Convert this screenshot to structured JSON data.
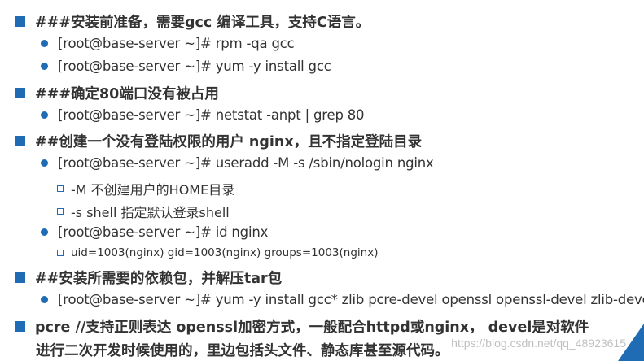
{
  "lines": [
    {
      "level": 1,
      "text": "###安装前准备，需要gcc 编译工具，支持C语言。"
    },
    {
      "level": 2,
      "text": "[root@base-server ~]# rpm -qa gcc"
    },
    {
      "level": 2,
      "text": "[root@base-server ~]# yum -y install gcc"
    },
    {
      "level": 1,
      "text": "###确定80端口没有被占用"
    },
    {
      "level": 2,
      "text": "[root@base-server ~]# netstat -anpt | grep 80"
    },
    {
      "level": 1,
      "text": "##创建一个没有登陆权限的用户 nginx，且不指定登陆目录"
    },
    {
      "level": 2,
      "text": "[root@base-server ~]# useradd -M -s /sbin/nologin nginx"
    },
    {
      "level": 3,
      "text": "-M 不创建用户的HOME目录"
    },
    {
      "level": 3,
      "text": "-s shell 指定默认登录shell"
    },
    {
      "level": 2,
      "text": "[root@base-server ~]# id nginx"
    },
    {
      "level": 3,
      "text": "uid=1003(nginx) gid=1003(nginx) groups=1003(nginx)"
    },
    {
      "level": 1,
      "text": "##安装所需要的依赖包，并解压tar包"
    },
    {
      "level": 2,
      "text": "[root@base-server ~]# yum -y install gcc* zlib pcre-devel openssl openssl-devel zlib-devel"
    },
    {
      "level": 1,
      "text": "pcre //支持正则表达 openssl加密方式，一般配合httpd或nginx， devel是对软件"
    },
    {
      "level": 0,
      "text": "进行二次开发时候使用的，里边包括头文件、静态库甚至源代码。"
    }
  ],
  "watermark": "https://blog.csdn.net/qq_48923615",
  "colors": {
    "bullet": "#1f6cb5",
    "text": "#333333"
  }
}
